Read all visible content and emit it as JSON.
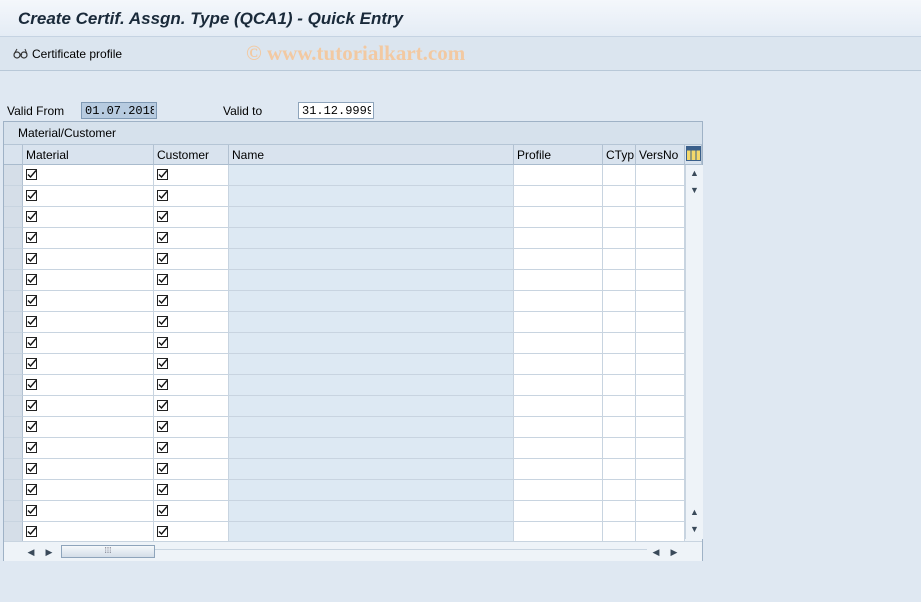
{
  "window": {
    "title": "Create Certif. Assgn. Type (QCA1) - Quick Entry"
  },
  "watermark": "© www.tutorialkart.com",
  "toolbar": {
    "certificate_profile_label": "Certificate profile"
  },
  "form": {
    "valid_from_label": "Valid From",
    "valid_from_value": "01.07.2018",
    "valid_to_label": "Valid to",
    "valid_to_value": "31.12.9999"
  },
  "table": {
    "title": "Material/Customer",
    "columns": [
      "Material",
      "Customer",
      "Name",
      "Profile",
      "CTyp",
      "VersNo"
    ],
    "row_count": 18,
    "rows": [
      {
        "material_checked": true,
        "customer_checked": true,
        "name": "",
        "profile": "",
        "ctyp": "",
        "versno": ""
      },
      {
        "material_checked": true,
        "customer_checked": true,
        "name": "",
        "profile": "",
        "ctyp": "",
        "versno": ""
      },
      {
        "material_checked": true,
        "customer_checked": true,
        "name": "",
        "profile": "",
        "ctyp": "",
        "versno": ""
      },
      {
        "material_checked": true,
        "customer_checked": true,
        "name": "",
        "profile": "",
        "ctyp": "",
        "versno": ""
      },
      {
        "material_checked": true,
        "customer_checked": true,
        "name": "",
        "profile": "",
        "ctyp": "",
        "versno": ""
      },
      {
        "material_checked": true,
        "customer_checked": true,
        "name": "",
        "profile": "",
        "ctyp": "",
        "versno": ""
      },
      {
        "material_checked": true,
        "customer_checked": true,
        "name": "",
        "profile": "",
        "ctyp": "",
        "versno": ""
      },
      {
        "material_checked": true,
        "customer_checked": true,
        "name": "",
        "profile": "",
        "ctyp": "",
        "versno": ""
      },
      {
        "material_checked": true,
        "customer_checked": true,
        "name": "",
        "profile": "",
        "ctyp": "",
        "versno": ""
      },
      {
        "material_checked": true,
        "customer_checked": true,
        "name": "",
        "profile": "",
        "ctyp": "",
        "versno": ""
      },
      {
        "material_checked": true,
        "customer_checked": true,
        "name": "",
        "profile": "",
        "ctyp": "",
        "versno": ""
      },
      {
        "material_checked": true,
        "customer_checked": true,
        "name": "",
        "profile": "",
        "ctyp": "",
        "versno": ""
      },
      {
        "material_checked": true,
        "customer_checked": true,
        "name": "",
        "profile": "",
        "ctyp": "",
        "versno": ""
      },
      {
        "material_checked": true,
        "customer_checked": true,
        "name": "",
        "profile": "",
        "ctyp": "",
        "versno": ""
      },
      {
        "material_checked": true,
        "customer_checked": true,
        "name": "",
        "profile": "",
        "ctyp": "",
        "versno": ""
      },
      {
        "material_checked": true,
        "customer_checked": true,
        "name": "",
        "profile": "",
        "ctyp": "",
        "versno": ""
      },
      {
        "material_checked": true,
        "customer_checked": true,
        "name": "",
        "profile": "",
        "ctyp": "",
        "versno": ""
      },
      {
        "material_checked": true,
        "customer_checked": true,
        "name": "",
        "profile": "",
        "ctyp": "",
        "versno": ""
      }
    ]
  },
  "icons": {
    "certificate_profile": "glasses-icon",
    "column_settings": "column-settings-icon",
    "checkbox": "checkbox-icon",
    "scroll_up": "arrow-up-icon",
    "scroll_down": "arrow-down-icon",
    "scroll_left": "arrow-left-icon",
    "scroll_right": "arrow-right-icon"
  },
  "colors": {
    "background": "#dfe8f2",
    "name_column": "#dde9f3",
    "valid_from_field": "#b7cbe0",
    "watermark": "#f2c9a2"
  }
}
